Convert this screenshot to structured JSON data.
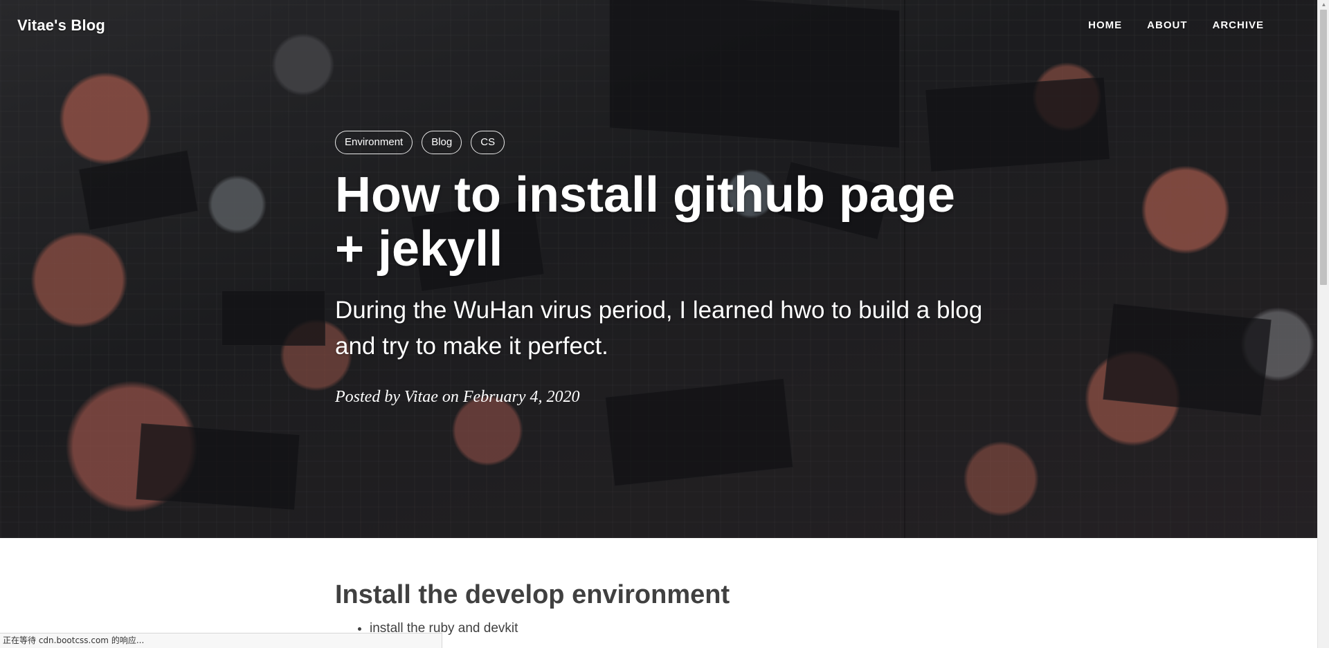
{
  "nav": {
    "brand": "Vitae's Blog",
    "links": [
      "HOME",
      "ABOUT",
      "ARCHIVE"
    ]
  },
  "post": {
    "tags": [
      "Environment",
      "Blog",
      "CS"
    ],
    "title": "How to install github page + jekyll",
    "subtitle": "During the WuHan virus period, I learned hwo to build a blog and try to make it perfect.",
    "meta": "Posted by Vitae on February 4, 2020"
  },
  "article": {
    "heading": "Install the develop environment",
    "items": [
      "install the ruby and devkit"
    ]
  },
  "statusbar": {
    "text": "正在等待 cdn.bootcss.com 的响应..."
  },
  "colors": {
    "hero_overlay": "#2a2a2d",
    "accent_copper": "#c46e5f",
    "body_text": "#404040"
  },
  "icons": {
    "scroll_up": "triangle-up",
    "scroll_down": "triangle-down"
  }
}
